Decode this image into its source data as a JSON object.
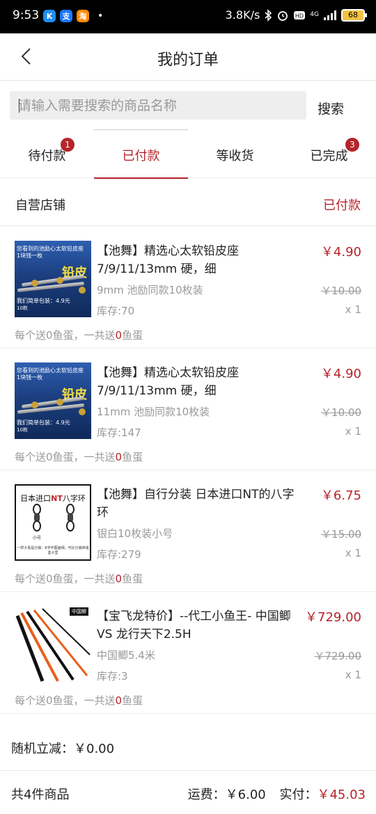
{
  "status_bar": {
    "time": "9:53",
    "net_speed": "3.8K/s",
    "network": "4G",
    "battery": "68",
    "apps": [
      {
        "name": "k-app-icon",
        "glyph": "K",
        "color": "#1e8ef0"
      },
      {
        "name": "alipay-icon",
        "glyph": "支",
        "color": "#1677ff"
      },
      {
        "name": "orange-app-icon",
        "glyph": "淘",
        "color": "#ff8a00"
      }
    ],
    "dot": "•"
  },
  "header": {
    "title": "我的订单"
  },
  "search": {
    "placeholder": "请输入需要搜索的商品名称",
    "button": "搜索"
  },
  "tabs": [
    {
      "label": "待付款",
      "badge": "1"
    },
    {
      "label": "已付款",
      "badge": ""
    },
    {
      "label": "等收货",
      "badge": ""
    },
    {
      "label": "已完成",
      "badge": "3"
    }
  ],
  "store": {
    "name": "自营店铺",
    "status": "已付款"
  },
  "items": [
    {
      "title": "【池舞】精选心太软铅皮座7/9/11/13mm 硬，细",
      "price": "￥4.90",
      "spec": "9mm 池励同款10枚装",
      "original_price": "￥10.00",
      "stock": "库存:70",
      "qty": "x 1",
      "bonus_prefix": "每个送0鱼蛋，一共送",
      "bonus_count": "0",
      "bonus_suffix": "鱼蛋",
      "thumb": {
        "line1": "您看到的池励心太软铅皮座",
        "line2": "1块钱一枚",
        "big": "铅皮",
        "line3": "我们简单包装：4.9元",
        "line4": "10枚"
      }
    },
    {
      "title": "【池舞】精选心太软铅皮座7/9/11/13mm 硬，细",
      "price": "￥4.90",
      "spec": "11mm 池励同款10枚装",
      "original_price": "￥10.00",
      "stock": "库存:147",
      "qty": "x 1",
      "bonus_prefix": "每个送0鱼蛋，一共送",
      "bonus_count": "0",
      "bonus_suffix": "鱼蛋",
      "thumb": {
        "line1": "您看到的池励心太软铅皮座",
        "line2": "1块钱一枚",
        "big": "铅皮",
        "line3": "我们简单包装：4.9元",
        "line4": "10枚"
      }
    },
    {
      "title": "【池舞】自行分装 日本进口NT的八字环",
      "price": "￥6.75",
      "spec": "银白10枚装小号",
      "original_price": "￥15.00",
      "stock": "库存:279",
      "qty": "x 1",
      "bonus_prefix": "每个送0鱼蛋，一共送",
      "bonus_count": "0",
      "bonus_suffix": "鱼蛋",
      "thumb": {
        "title_a": "日本进口",
        "title_nt": "NT",
        "title_b": "八字环",
        "label": "小号",
        "foot": "一样子看是分装：8字环图画相，可比分装转组盒子里"
      }
    },
    {
      "title": "【宝飞龙特价】--代工小鱼王- 中国鲫 VS 龙行天下2.5H",
      "price": "￥729.00",
      "spec": "中国鲫5.4米",
      "original_price": "￥729.00",
      "stock": "库存:3",
      "qty": "x 1",
      "bonus_prefix": "每个送0鱼蛋，一共送",
      "bonus_count": "0",
      "bonus_suffix": "鱼蛋",
      "thumb": {
        "brand": "中国鲫"
      }
    }
  ],
  "discount": {
    "text": "随机立减：￥0.00"
  },
  "total": {
    "count": "共4件商品",
    "shipping": "运费：￥6.00",
    "paid_label": "实付：",
    "paid_value": "￥45.03"
  },
  "colors": {
    "accent": "#b5242a",
    "muted": "#999999"
  }
}
